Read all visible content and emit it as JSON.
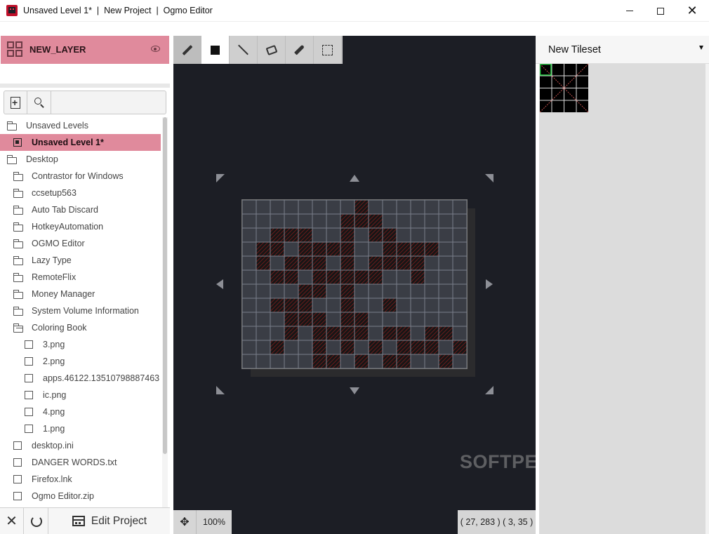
{
  "window": {
    "title": "Unsaved Level 1*  |  New Project  |  Ogmo Editor",
    "minimize_icon": "minimize-icon",
    "maximize_icon": "maximize-icon",
    "close_icon": "close-icon"
  },
  "layer": {
    "name": "NEW_LAYER",
    "icon": "grid-layer-icon",
    "visibility_icon": "eye-icon"
  },
  "tree": {
    "items": [
      {
        "label": "Unsaved Levels",
        "kind": "folder-root"
      },
      {
        "label": "Unsaved Level 1*",
        "kind": "level",
        "selected": true
      },
      {
        "label": "Desktop",
        "kind": "folder-root"
      },
      {
        "label": "Contrastor for Windows",
        "kind": "folder"
      },
      {
        "label": "ccsetup563",
        "kind": "folder"
      },
      {
        "label": "Auto Tab Discard",
        "kind": "folder"
      },
      {
        "label": "HotkeyAutomation",
        "kind": "folder"
      },
      {
        "label": "OGMO Editor",
        "kind": "folder"
      },
      {
        "label": "Lazy Type",
        "kind": "folder"
      },
      {
        "label": "RemoteFlix",
        "kind": "folder"
      },
      {
        "label": "Money Manager",
        "kind": "folder"
      },
      {
        "label": "System Volume Information",
        "kind": "folder"
      },
      {
        "label": "Coloring Book",
        "kind": "folder-open"
      },
      {
        "label": "3.png",
        "kind": "file-nested"
      },
      {
        "label": "2.png",
        "kind": "file-nested"
      },
      {
        "label": "apps.46122.13510798887463",
        "kind": "file-nested"
      },
      {
        "label": "ic.png",
        "kind": "file-nested"
      },
      {
        "label": "4.png",
        "kind": "file-nested"
      },
      {
        "label": "1.png",
        "kind": "file-nested"
      },
      {
        "label": "desktop.ini",
        "kind": "file"
      },
      {
        "label": "DANGER WORDS.txt",
        "kind": "file"
      },
      {
        "label": "Firefox.lnk",
        "kind": "file"
      },
      {
        "label": "Ogmo Editor.zip",
        "kind": "file"
      }
    ]
  },
  "bottom": {
    "edit_label": "Edit Project"
  },
  "tools": [
    "pencil-icon",
    "rectangle-icon",
    "line-icon",
    "fill-icon",
    "eyedropper-icon",
    "select-icon"
  ],
  "status": {
    "zoom": "100%",
    "coords": "( 27, 283 ) ( 3, 35 )"
  },
  "watermark": "SOFTPEDIA",
  "tileset": {
    "name": "New Tileset"
  },
  "colors": {
    "accent": "#e08a9c",
    "editor_bg": "#1c1e25",
    "tile_fill": "#6b1a1a",
    "selected_tile": "#2fd14a"
  },
  "map_grid": {
    "columns": 16,
    "rows": 12
  },
  "painted_tiles": [
    [
      8,
      0
    ],
    [
      7,
      1
    ],
    [
      8,
      1
    ],
    [
      9,
      1
    ],
    [
      2,
      2
    ],
    [
      3,
      2
    ],
    [
      4,
      2
    ],
    [
      7,
      2
    ],
    [
      9,
      2
    ],
    [
      10,
      2
    ],
    [
      1,
      3
    ],
    [
      2,
      3
    ],
    [
      4,
      3
    ],
    [
      5,
      3
    ],
    [
      6,
      3
    ],
    [
      7,
      3
    ],
    [
      10,
      3
    ],
    [
      11,
      3
    ],
    [
      12,
      3
    ],
    [
      13,
      3
    ],
    [
      1,
      4
    ],
    [
      3,
      4
    ],
    [
      4,
      4
    ],
    [
      5,
      4
    ],
    [
      7,
      4
    ],
    [
      9,
      4
    ],
    [
      10,
      4
    ],
    [
      11,
      4
    ],
    [
      12,
      4
    ],
    [
      2,
      5
    ],
    [
      3,
      5
    ],
    [
      5,
      5
    ],
    [
      6,
      5
    ],
    [
      7,
      5
    ],
    [
      8,
      5
    ],
    [
      9,
      5
    ],
    [
      12,
      5
    ],
    [
      4,
      6
    ],
    [
      5,
      6
    ],
    [
      7,
      6
    ],
    [
      2,
      7
    ],
    [
      3,
      7
    ],
    [
      4,
      7
    ],
    [
      7,
      7
    ],
    [
      10,
      7
    ],
    [
      3,
      8
    ],
    [
      4,
      8
    ],
    [
      5,
      8
    ],
    [
      7,
      8
    ],
    [
      8,
      8
    ],
    [
      3,
      9
    ],
    [
      5,
      9
    ],
    [
      6,
      9
    ],
    [
      7,
      9
    ],
    [
      8,
      9
    ],
    [
      10,
      9
    ],
    [
      11,
      9
    ],
    [
      13,
      9
    ],
    [
      14,
      9
    ],
    [
      2,
      10
    ],
    [
      5,
      10
    ],
    [
      7,
      10
    ],
    [
      9,
      10
    ],
    [
      11,
      10
    ],
    [
      12,
      10
    ],
    [
      13,
      10
    ],
    [
      15,
      10
    ],
    [
      5,
      11
    ],
    [
      6,
      11
    ],
    [
      8,
      11
    ],
    [
      10,
      11
    ],
    [
      11,
      11
    ],
    [
      14,
      11
    ]
  ]
}
